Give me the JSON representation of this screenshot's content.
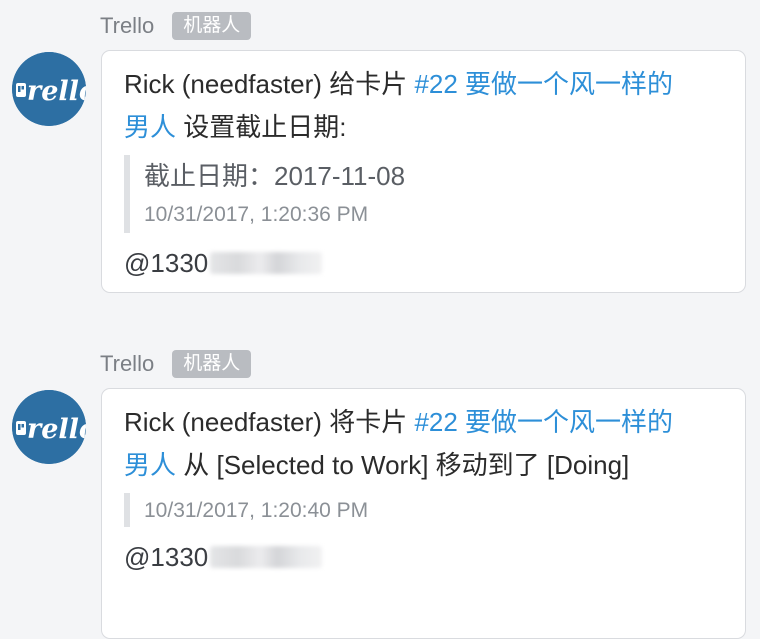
{
  "messages": [
    {
      "sender": "Trello",
      "badge": "机器人",
      "avatar_icon": "trello-logo-icon",
      "actor": "Rick (needfaster)",
      "verb": "给卡片",
      "card_ref": "#22 要做一个风一样的",
      "card_ref_cont": "男人",
      "rest": "设置截止日期:",
      "quote_main": "截止日期：2017-11-08",
      "timestamp": "10/31/2017, 1:20:36 PM",
      "mention": "@1330"
    },
    {
      "sender": "Trello",
      "badge": "机器人",
      "avatar_icon": "trello-logo-icon",
      "actor": "Rick (needfaster)",
      "verb": "将卡片",
      "card_ref": "#22 要做一个风一样的",
      "card_ref_cont": "男人",
      "rest": "从 [Selected to Work] 移动到了 [Doing]",
      "timestamp": "10/31/2017, 1:20:40 PM",
      "mention": "@1330"
    }
  ],
  "colors": {
    "link": "#2d8fd8",
    "avatar_bg": "#2d6fa3",
    "badge_bg": "#b9bcc1",
    "background": "#f4f5f7"
  }
}
